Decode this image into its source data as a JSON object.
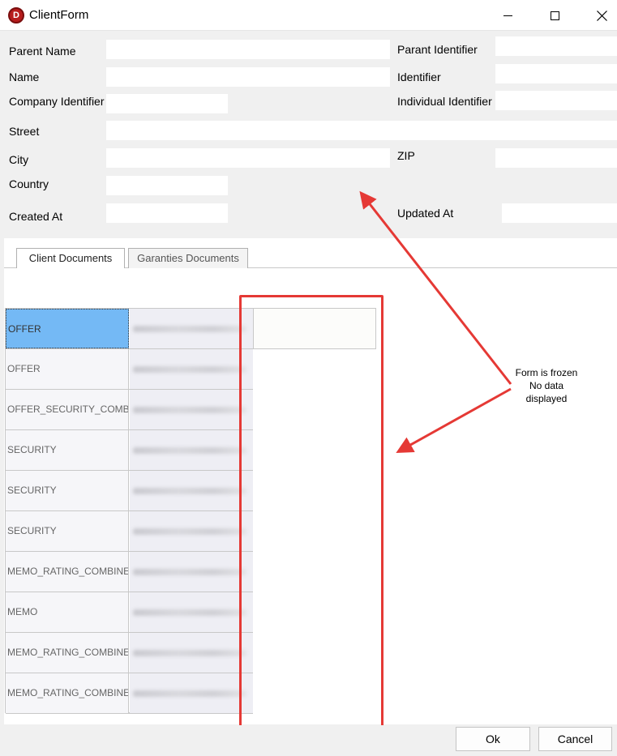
{
  "window": {
    "title": "ClientForm",
    "app_icon_letter": "D"
  },
  "form": {
    "labels": {
      "parent_name": "Parent Name",
      "parent_identifier": "Parant Identifier",
      "name": "Name",
      "identifier": "Identifier",
      "company_identifier": "Company Identifier",
      "individual_identifier": "Individual Identifier",
      "street": "Street",
      "city": "City",
      "zip": "ZIP",
      "country": "Country",
      "created_at": "Created At",
      "updated_at": "Updated At"
    }
  },
  "tabs": [
    {
      "label": "Client Documents",
      "active": true
    },
    {
      "label": "Garanties Documents",
      "active": false
    }
  ],
  "documents": {
    "rows": [
      {
        "type": "OFFER",
        "selected": true
      },
      {
        "type": "OFFER",
        "selected": false
      },
      {
        "type": "OFFER_SECURITY_COMBINED",
        "selected": false
      },
      {
        "type": "SECURITY",
        "selected": false
      },
      {
        "type": "SECURITY",
        "selected": false
      },
      {
        "type": "SECURITY",
        "selected": false
      },
      {
        "type": "MEMO_RATING_COMBINED",
        "selected": false
      },
      {
        "type": "MEMO",
        "selected": false
      },
      {
        "type": "MEMO_RATING_COMBINED",
        "selected": false
      },
      {
        "type": "MEMO_RATING_COMBINED",
        "selected": false
      }
    ]
  },
  "annotation": {
    "lines": [
      "Form is frozen",
      "No data",
      "displayed"
    ],
    "color": "#e53935"
  },
  "footer": {
    "ok_label": "Ok",
    "cancel_label": "Cancel"
  }
}
